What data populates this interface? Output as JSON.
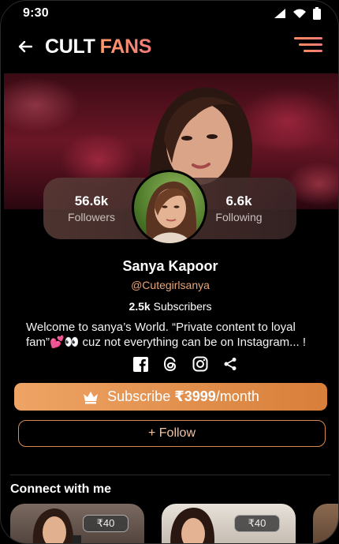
{
  "status_bar": {
    "time": "9:30"
  },
  "header": {
    "brand_part1": "CULT",
    "brand_part2": "FANS"
  },
  "profile": {
    "followers_count": "56.6k",
    "followers_label": "Followers",
    "following_count": "6.6k",
    "following_label": "Following",
    "name": "Sanya Kapoor",
    "handle": "@Cutegirlsanya",
    "subscribers_count": "2.5k",
    "subscribers_label": "Subscribers",
    "bio": "Welcome to sanya’s World. “Private content to loyal fam”💕👀 cuz not everything can be on Instagram... !"
  },
  "socials": [
    "facebook-icon",
    "threads-icon",
    "instagram-icon",
    "share-icon"
  ],
  "subscribe": {
    "prefix": "Subscribe",
    "price": "₹3999",
    "suffix": "/month"
  },
  "follow_label": "+ Follow",
  "connect": {
    "title": "Connect with me",
    "cards": [
      {
        "price": "₹40"
      },
      {
        "price": "₹40"
      }
    ]
  },
  "colors": {
    "accent": "#e8965a",
    "brand_gradient_start": "#ff9a6a",
    "brand_gradient_end": "#f07b7b",
    "handle": "#e9a577"
  }
}
